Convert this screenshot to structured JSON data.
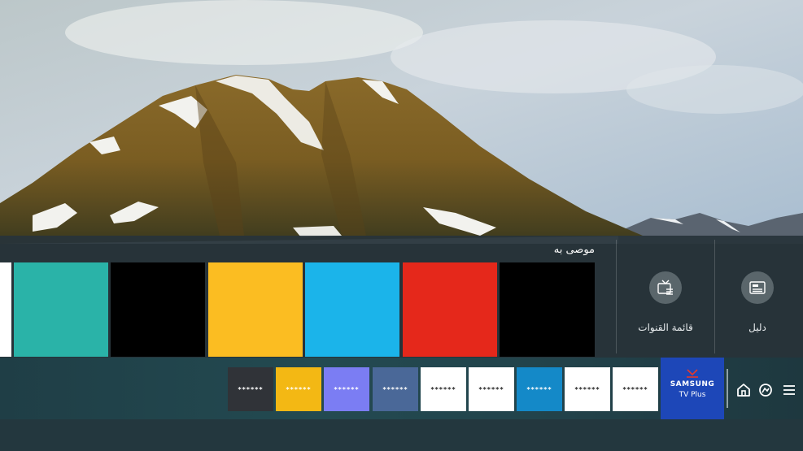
{
  "recommended": {
    "title": "موصى به",
    "tiles": [
      {
        "name": "tile-white",
        "color": "#ffffff"
      },
      {
        "name": "tile-teal",
        "color": "#2ab3a8"
      },
      {
        "name": "tile-black",
        "color": "#000000"
      },
      {
        "name": "tile-yellow",
        "color": "#fbbd22"
      },
      {
        "name": "tile-blue",
        "color": "#1bb4ea"
      },
      {
        "name": "tile-red",
        "color": "#e5281b"
      },
      {
        "name": "tile-black",
        "color": "#000000"
      }
    ]
  },
  "quick_menu": {
    "channel_list_label": "قائمة القنوات",
    "guide_label": "دليل",
    "channel_list_icon": "channel-list-icon",
    "guide_icon": "guide-icon"
  },
  "apps_bar": {
    "apps": [
      {
        "label": "******",
        "bg": "#303338",
        "fg": "#ffffff"
      },
      {
        "label": "******",
        "bg": "#f3b814",
        "fg": "#ffffff"
      },
      {
        "label": "******",
        "bg": "#7b7df3",
        "fg": "#ffffff"
      },
      {
        "label": "******",
        "bg": "#4a6898",
        "fg": "#ffffff"
      },
      {
        "label": "******",
        "bg": "#ffffff",
        "fg": "#222222"
      },
      {
        "label": "******",
        "bg": "#ffffff",
        "fg": "#222222"
      },
      {
        "label": "******",
        "bg": "#1489c8",
        "fg": "#ffffff"
      },
      {
        "label": "******",
        "bg": "#ffffff",
        "fg": "#222222"
      },
      {
        "label": "******",
        "bg": "#ffffff",
        "fg": "#222222"
      }
    ],
    "tv_plus": {
      "line1": "SAMSUNG",
      "line2": "TV Plus",
      "bg": "#1d47b8"
    },
    "nav_icons": [
      "home-icon",
      "ambient-icon",
      "menu-icon"
    ]
  }
}
